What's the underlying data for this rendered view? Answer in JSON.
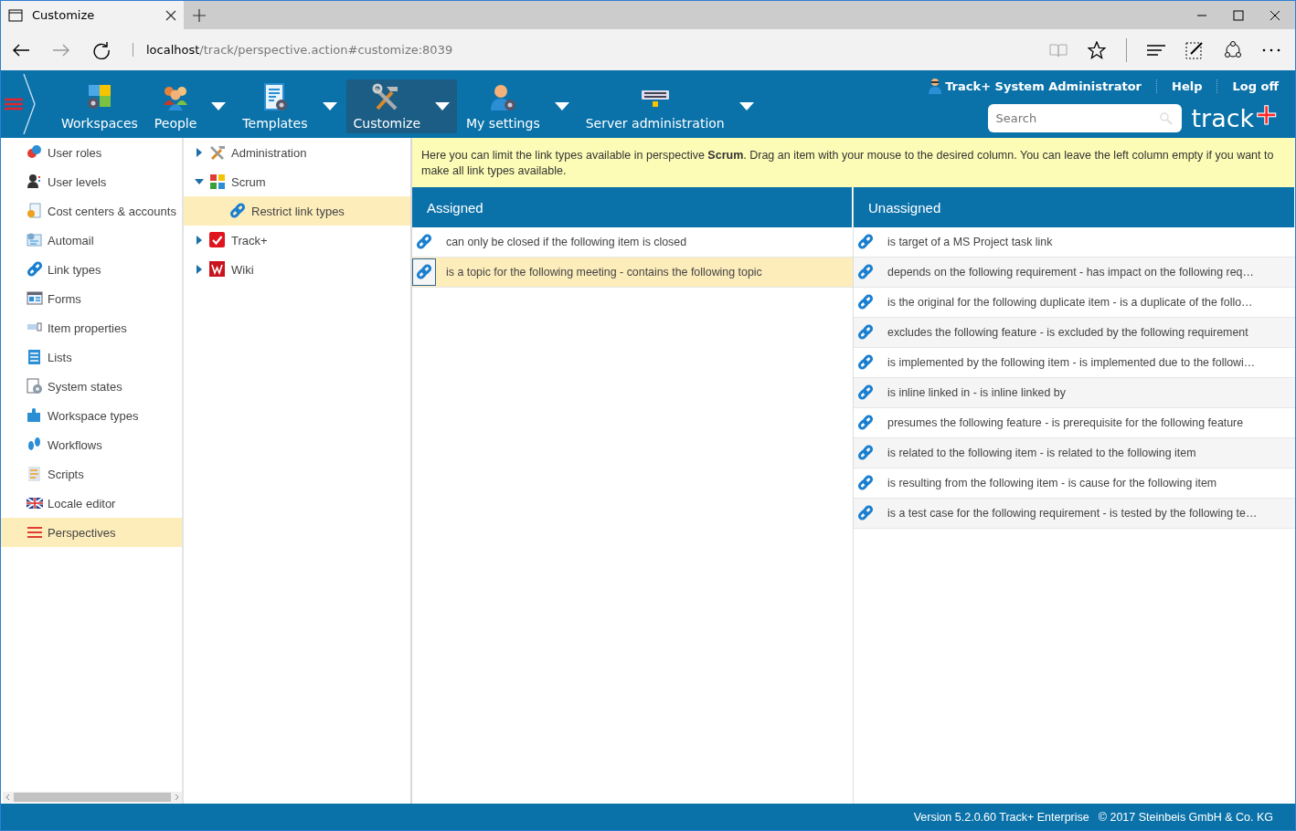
{
  "browser": {
    "tab_title": "Customize",
    "url_host": "localhost",
    "url_path": "/track/perspective.action#customize:8039"
  },
  "app_header": {
    "nav": [
      {
        "label": "Workspaces",
        "selected": false,
        "dropdown": false
      },
      {
        "label": "People",
        "selected": false,
        "dropdown": true
      },
      {
        "label": "Templates",
        "selected": false,
        "dropdown": true
      },
      {
        "label": "Customize",
        "selected": true,
        "dropdown": true
      },
      {
        "label": "My settings",
        "selected": false,
        "dropdown": true
      },
      {
        "label": "Server administration",
        "selected": false,
        "dropdown": true
      }
    ],
    "user": "Track+ System Administrator",
    "links": [
      "Help",
      "Log off"
    ],
    "search": {
      "placeholder": "Search"
    },
    "logo": {
      "text": "track",
      "mark": "+"
    }
  },
  "sidebar": {
    "items": [
      {
        "label": "User roles",
        "selected": false
      },
      {
        "label": "User levels",
        "selected": false
      },
      {
        "label": "Cost centers & accounts",
        "selected": false
      },
      {
        "label": "Automail",
        "selected": false
      },
      {
        "label": "Link types",
        "selected": false
      },
      {
        "label": "Forms",
        "selected": false
      },
      {
        "label": "Item properties",
        "selected": false
      },
      {
        "label": "Lists",
        "selected": false
      },
      {
        "label": "System states",
        "selected": false
      },
      {
        "label": "Workspace types",
        "selected": false
      },
      {
        "label": "Workflows",
        "selected": false
      },
      {
        "label": "Scripts",
        "selected": false
      },
      {
        "label": "Locale editor",
        "selected": false
      },
      {
        "label": "Perspectives",
        "selected": true
      }
    ]
  },
  "tree": {
    "items": [
      {
        "label": "Administration",
        "expanded": false,
        "selected": false
      },
      {
        "label": "Scrum",
        "expanded": true,
        "selected": false,
        "children": [
          {
            "label": "Restrict link types",
            "selected": true
          }
        ]
      },
      {
        "label": "Track+",
        "expanded": false,
        "selected": false
      },
      {
        "label": "Wiki",
        "expanded": false,
        "selected": false
      }
    ]
  },
  "info": "Here you can limit the link types available in perspective **Scrum**. Drag an item with your mouse to the desired column. You can leave the left column empty if you want to make all link types available.",
  "columns": [
    {
      "title": "Assigned",
      "items": [
        {
          "label": "can only be closed if the following item is closed",
          "selected": false
        },
        {
          "label": "is a topic for the following meeting - contains the following topic",
          "selected": true
        }
      ]
    },
    {
      "title": "Unassigned",
      "items": [
        {
          "label": "is target of a MS Project task link",
          "selected": false
        },
        {
          "label": "depends on the following requirement - has impact on the following req…",
          "selected": false
        },
        {
          "label": "is the original for the following duplicate item - is a duplicate of the follo…",
          "selected": false
        },
        {
          "label": "excludes the following feature - is excluded by the following requirement",
          "selected": false
        },
        {
          "label": "is implemented by the following item - is implemented due to the followi…",
          "selected": false
        },
        {
          "label": "is inline linked in - is inline linked by",
          "selected": false
        },
        {
          "label": "presumes the following feature - is prerequisite for the following feature",
          "selected": false
        },
        {
          "label": "is related to the following item - is related to the following item",
          "selected": false
        },
        {
          "label": "is resulting from the following item - is cause for the following item",
          "selected": false
        },
        {
          "label": "is a test case for the following requirement - is tested by the following te…",
          "selected": false
        }
      ]
    }
  ],
  "status_bar": {
    "version": "Version 5.2.0.60 Track+ Enterprise",
    "copyright": "© 2017 Steinbeis GmbH & Co. KG"
  }
}
